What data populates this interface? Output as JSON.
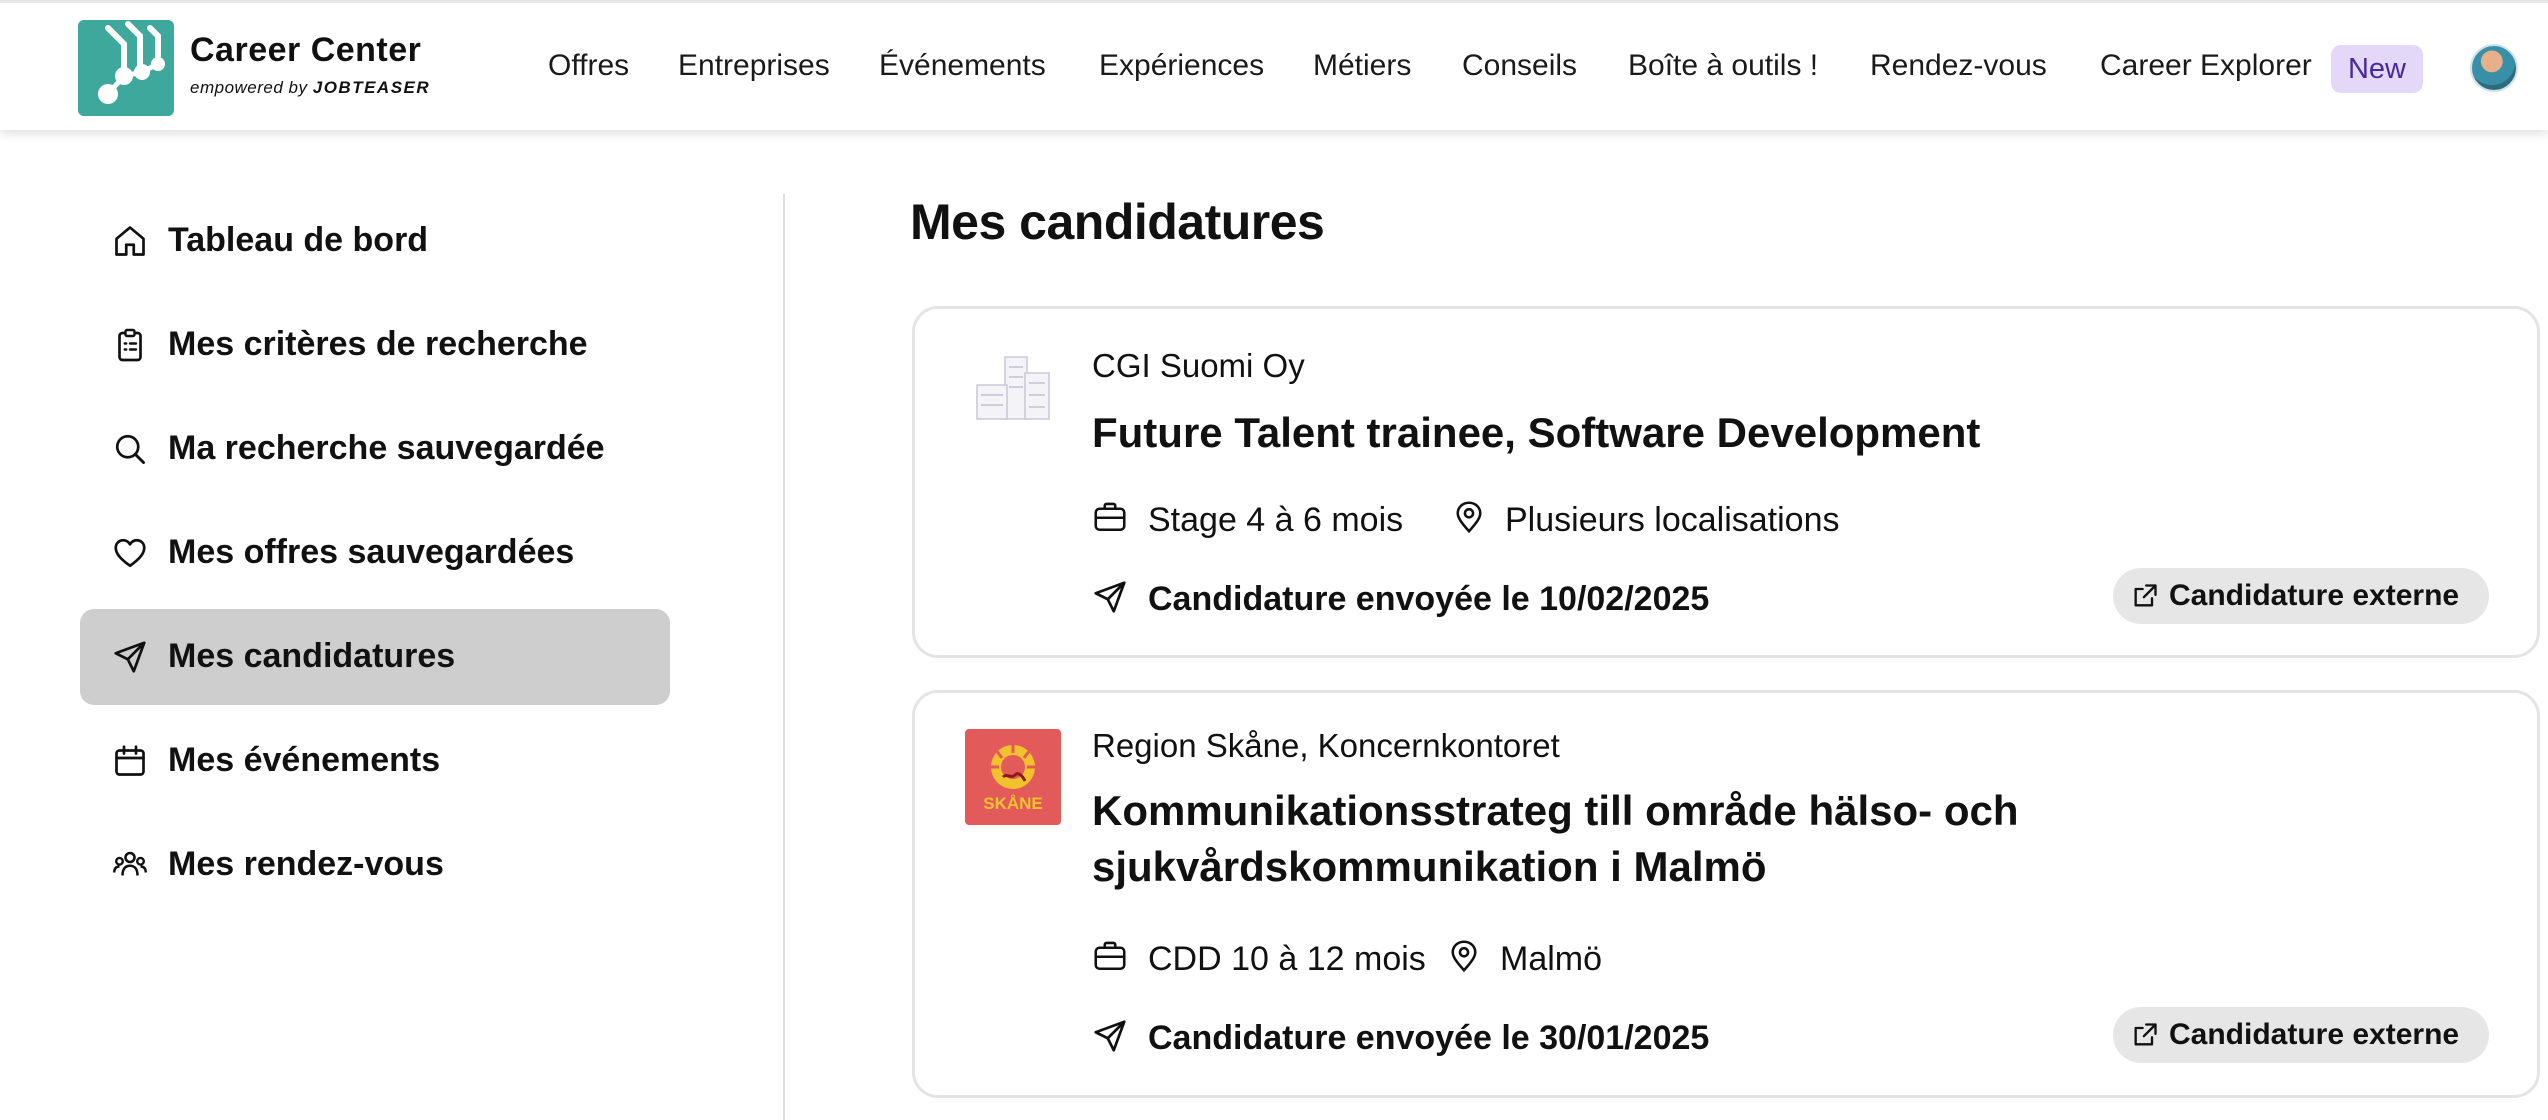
{
  "header": {
    "brand_title": "Career Center",
    "brand_sub_prefix": "empowered by",
    "brand_sub_name": "JOBTEASER",
    "nav": [
      "Offres",
      "Entreprises",
      "Événements",
      "Expériences",
      "Métiers",
      "Conseils",
      "Boîte à outils !",
      "Rendez-vous",
      "Career Explorer"
    ],
    "new_badge": "New",
    "accent_color": "#3ea89c",
    "badge_color": "#e3d8f7"
  },
  "sidebar": {
    "items": [
      {
        "label": "Tableau de bord",
        "icon": "home-icon"
      },
      {
        "label": "Mes critères de recherche",
        "icon": "clipboard-icon"
      },
      {
        "label": "Ma recherche sauvegardée",
        "icon": "search-icon"
      },
      {
        "label": "Mes offres sauvegardées",
        "icon": "heart-icon"
      },
      {
        "label": "Mes candidatures",
        "icon": "send-icon",
        "active": true
      },
      {
        "label": "Mes événements",
        "icon": "calendar-icon"
      },
      {
        "label": "Mes rendez-vous",
        "icon": "people-icon"
      }
    ],
    "active_color": "#cecece"
  },
  "main": {
    "title": "Mes candidatures",
    "applications": [
      {
        "company": "CGI Suomi Oy",
        "title": "Future Talent trainee, Software Development",
        "contract": "Stage 4 à 6 mois",
        "location": "Plusieurs localisations",
        "sent": "Candidature envoyée le 10/02/2025",
        "action": "Candidature externe",
        "logo_icon": "building-icon"
      },
      {
        "company": "Region Skåne, Koncernkontoret",
        "title": "Kommunikationsstrateg till område hälso- och sjukvårdskommunikation i Malmö",
        "contract": "CDD 10 à 12 mois",
        "location": "Malmö",
        "sent": "Candidature envoyée le 30/01/2025",
        "action": "Candidature externe",
        "logo_text": "SKÅNE",
        "logo_color": "#e35a5a"
      }
    ]
  }
}
